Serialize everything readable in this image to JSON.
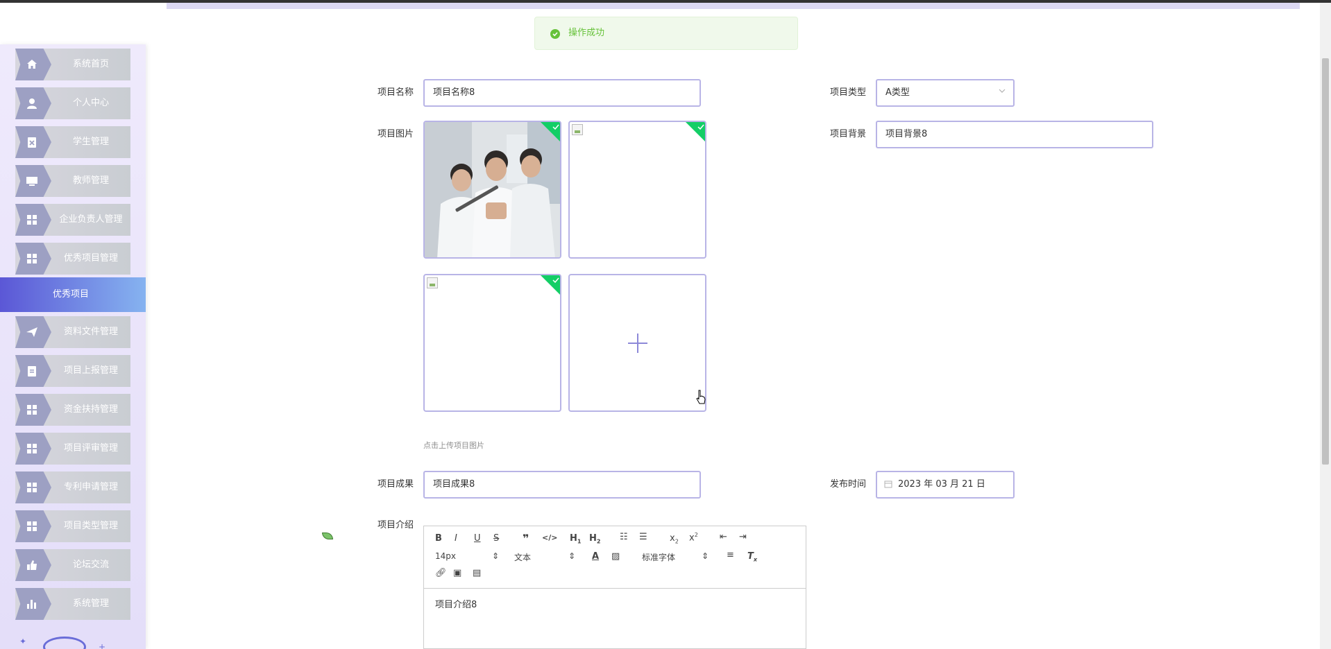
{
  "sidebar": {
    "items": [
      {
        "label": "系统首页",
        "icon": "home-icon"
      },
      {
        "label": "个人中心",
        "icon": "user-icon"
      },
      {
        "label": "学生管理",
        "icon": "clipboard-x-icon"
      },
      {
        "label": "教师管理",
        "icon": "monitor-icon"
      },
      {
        "label": "企业负责人管理",
        "icon": "grid-icon"
      },
      {
        "label": "优秀项目管理",
        "icon": "grid-icon"
      },
      {
        "label": "资料文件管理",
        "icon": "send-icon"
      },
      {
        "label": "项目上报管理",
        "icon": "clipboard-icon"
      },
      {
        "label": "资金扶持管理",
        "icon": "grid-icon"
      },
      {
        "label": "项目评审管理",
        "icon": "grid-icon"
      },
      {
        "label": "专利申请管理",
        "icon": "grid-icon"
      },
      {
        "label": "项目类型管理",
        "icon": "grid-icon"
      },
      {
        "label": "论坛交流",
        "icon": "thumb-icon"
      },
      {
        "label": "系统管理",
        "icon": "bar-chart-icon"
      }
    ],
    "active_sub": "优秀项目"
  },
  "toast": {
    "message": "操作成功"
  },
  "form": {
    "name_label": "项目名称",
    "name_value": "项目名称8",
    "type_label": "项目类型",
    "type_value": "A类型",
    "images_label": "项目图片",
    "images_hint": "点击上传项目图片",
    "background_label": "项目背景",
    "background_value": "项目背景8",
    "result_label": "项目成果",
    "result_value": "项目成果8",
    "publish_label": "发布时间",
    "publish_value": "2023 年 03 月 21 日",
    "intro_label": "项目介绍",
    "intro_value": "项目介绍8"
  },
  "editor": {
    "font_size": "14px",
    "text_style": "文本",
    "font_family": "标准字体"
  },
  "colors": {
    "accent": "#5b57d6",
    "success": "#67c23a",
    "input_border": "#b8b4e6",
    "upload_corner": "#13ce66"
  }
}
